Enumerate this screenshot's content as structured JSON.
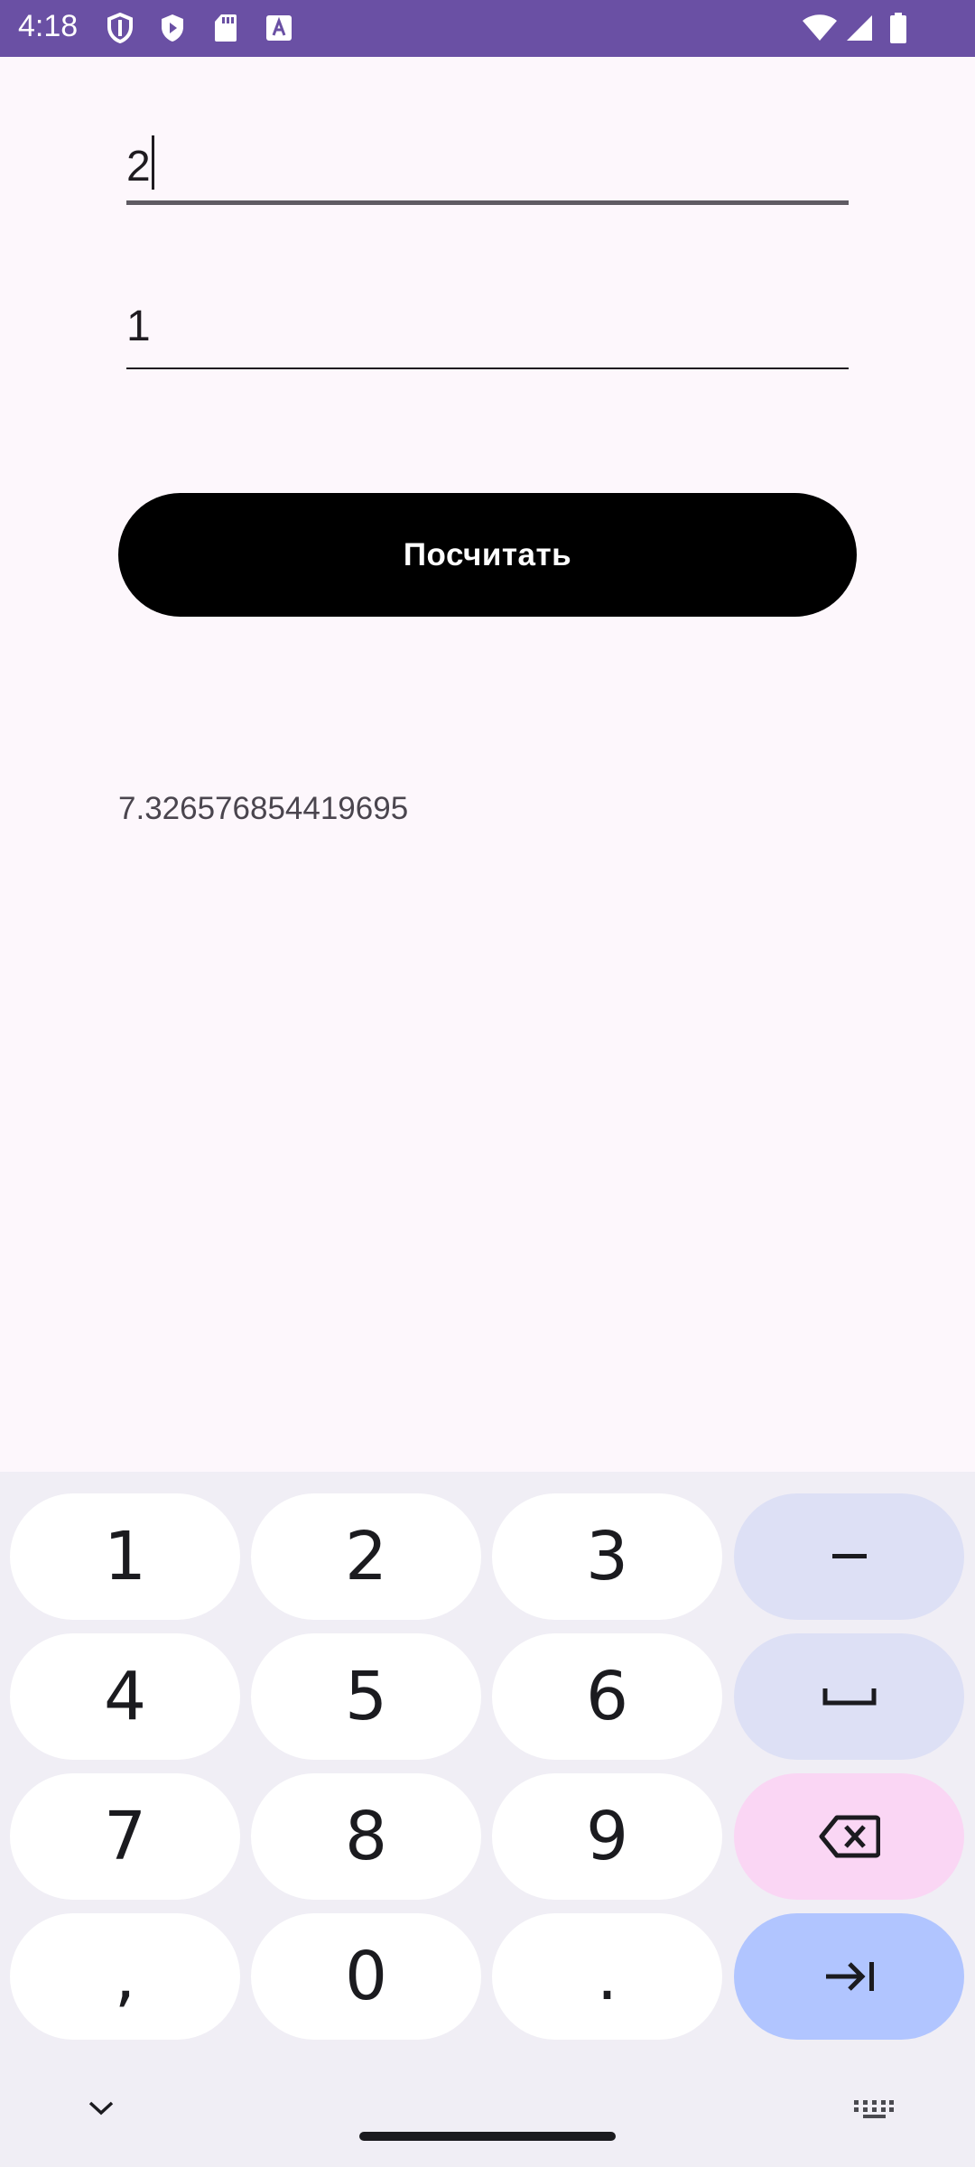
{
  "status_bar": {
    "time": "4:18",
    "left_icons": [
      "shield-icon",
      "play-protect-icon",
      "sd-card-icon",
      "text-a-icon"
    ],
    "right_icons": [
      "wifi-icon",
      "signal-icon",
      "battery-icon"
    ]
  },
  "form": {
    "field1_value": "2",
    "field2_value": "1",
    "calculate_label": "Посчитать",
    "result": "7.326576854419695"
  },
  "keyboard": {
    "keys": [
      "1",
      "2",
      "3",
      "–",
      "4",
      "5",
      "6",
      "␣",
      "7",
      "8",
      "9",
      "⌫",
      ",",
      "0",
      ".",
      "⇥"
    ],
    "bottom_icons": [
      "hide-keyboard-chevron-icon",
      "keyboard-switch-icon"
    ]
  },
  "colors": {
    "status_bar": "#6a50a4",
    "background": "#fdf7fc",
    "button": "#000000",
    "key_digit": "#ffffff",
    "key_function": "#dde0f5",
    "key_delete": "#fad6f4",
    "key_enter": "#b1c5ff"
  }
}
